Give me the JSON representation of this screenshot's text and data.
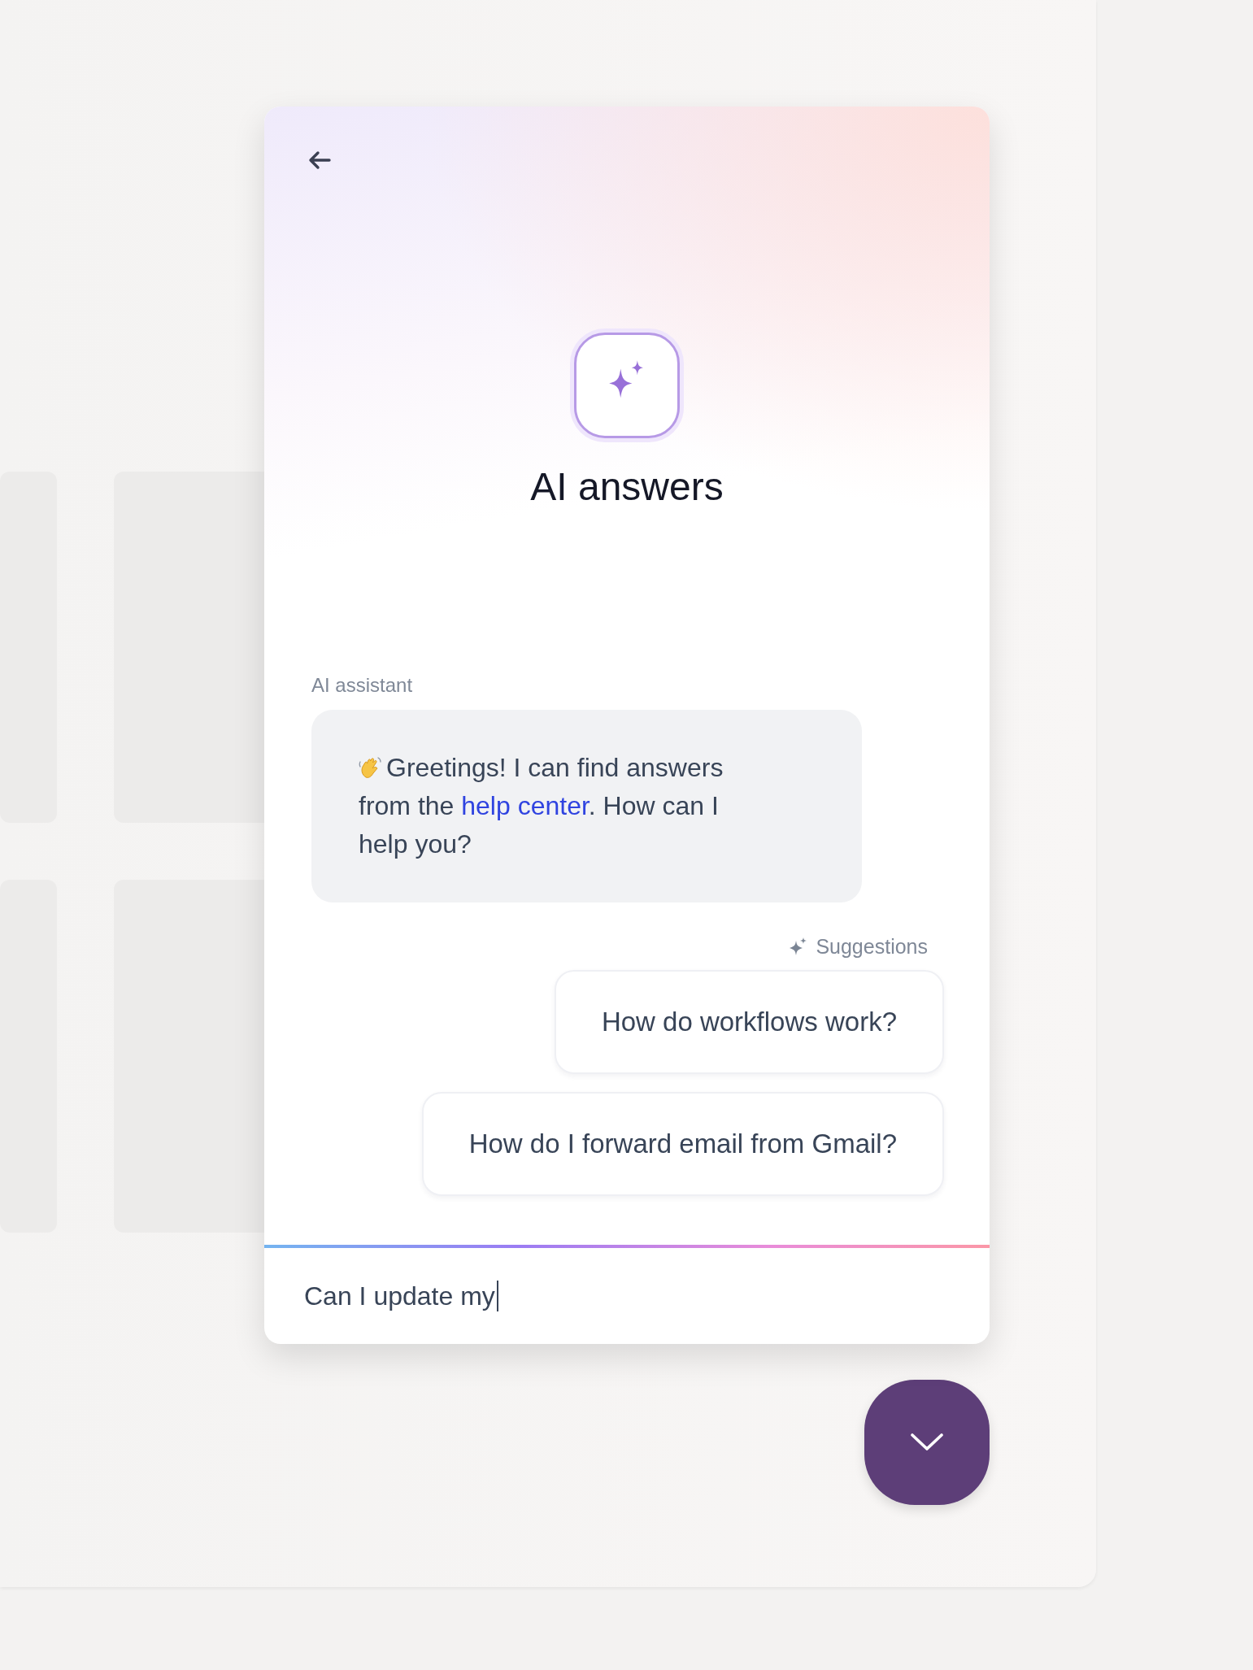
{
  "header": {
    "title": "AI answers"
  },
  "conversation": {
    "sender": "AI assistant",
    "message": {
      "text_before": "Greetings! I can find answers from the ",
      "link": "help center",
      "text_after": ". How can I help you?"
    }
  },
  "suggestions": {
    "label": "Suggestions",
    "items": [
      {
        "text": "How do workflows work?"
      },
      {
        "text": "How do I forward email from Gmail?"
      }
    ]
  },
  "composer": {
    "value": "Can I update my"
  }
}
